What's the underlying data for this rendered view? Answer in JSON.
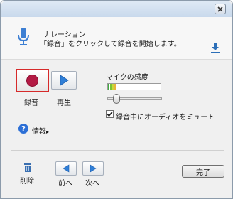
{
  "window": {
    "close_icon": "close-x-icon"
  },
  "header": {
    "title": "ナレーション",
    "description": "「録音」をクリックして録音を開始します。",
    "mic_icon": "microphone-icon",
    "download_icon": "download-arrow-icon"
  },
  "controls": {
    "record_label": "録音",
    "play_label": "再生",
    "record_color": "#b31a44",
    "play_color": "#2f7fd8"
  },
  "input": {
    "sensitivity_label": "マイクの感度",
    "mute_label": "録音中にオーディオをミュート",
    "mute_checked": true,
    "slider_level": 0.12
  },
  "info": {
    "label": "情報",
    "arrow": "▸"
  },
  "footer": {
    "delete_label": "削除",
    "prev_label": "前へ",
    "next_label": "次へ",
    "done_label": "完了"
  }
}
